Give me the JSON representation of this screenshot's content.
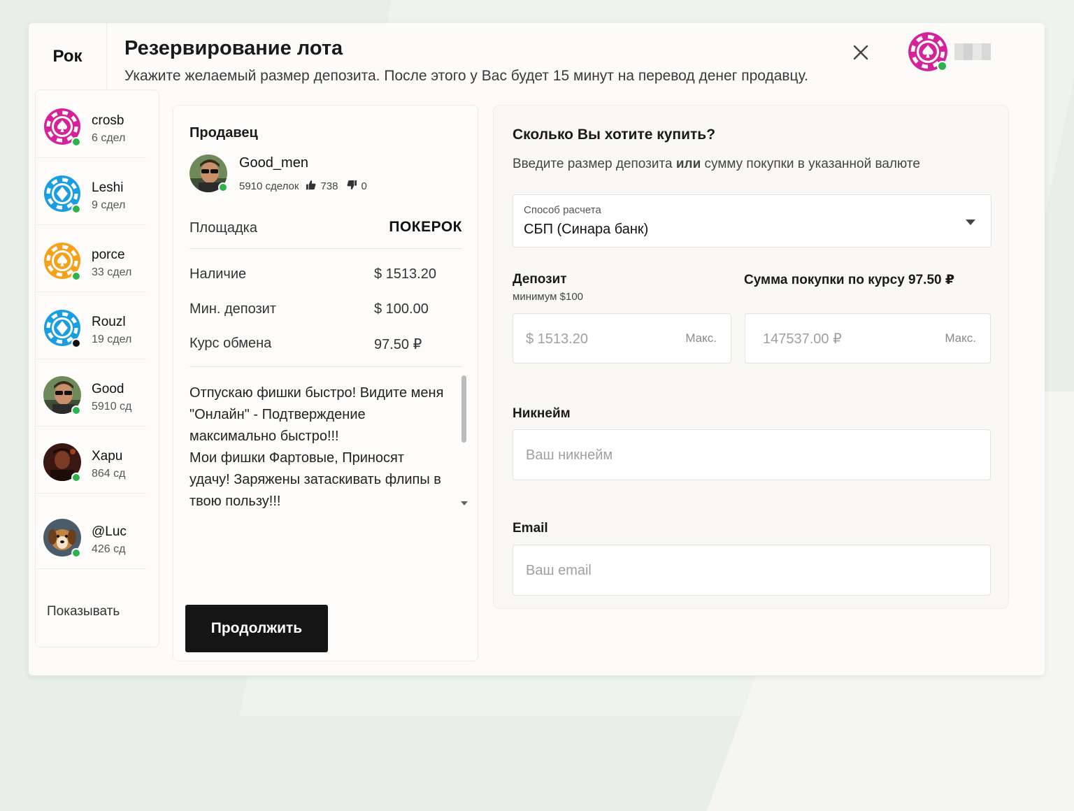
{
  "header": {
    "brand": "Рок",
    "title": "Резервирование лота",
    "subtitle": "Укажите желаемый размер депозита. После этого у Вас будет 15 минут на перевод денег продавцу."
  },
  "sidebar": {
    "items": [
      {
        "name": "crosb",
        "count": "6 сдел"
      },
      {
        "name": "Leshi",
        "count": "9 сдел"
      },
      {
        "name": "porce",
        "count": "33 сдел"
      },
      {
        "name": "Rouzl",
        "count": "19 сдел"
      },
      {
        "name": "Good",
        "count": "5910 сд"
      },
      {
        "name": "Xapu",
        "count": "864 сд"
      },
      {
        "name": "@Luc",
        "count": "426 сд"
      }
    ],
    "more_label": "Показывать"
  },
  "seller": {
    "heading": "Продавец",
    "name": "Good_men",
    "deals": "5910 сделок",
    "likes": "738",
    "dislikes": "0",
    "platform_label": "Площадка",
    "platform_value": "ПОКЕРОК",
    "available_label": "Наличие",
    "available_value": "$ 1513.20",
    "min_deposit_label": "Мин. депозит",
    "min_deposit_value": "$ 100.00",
    "rate_label": "Курс обмена",
    "rate_value": "97.50 ₽",
    "description_1": "Отпускаю фишки быстро! Видите меня \"Онлайн\" - Подтверждение максимально быстро!!!",
    "description_2": "Мои фишки Фартовые, Приносят удачу! Заряжены затаскивать флипы в твою пользу!!!",
    "continue_label": "Продолжить"
  },
  "form": {
    "heading": "Сколько Вы хотите купить?",
    "hint_before": "Введите размер депозита ",
    "hint_bold": "или",
    "hint_after": " сумму покупки в указанной валюте",
    "payment_label": "Способ расчета",
    "payment_value": "СБП (Синара банк)",
    "deposit_label": "Депозит",
    "deposit_sub": "минимум $100",
    "deposit_placeholder": "$ 1513.20",
    "purchase_label": "Сумма покупки по курсу 97.50 ₽",
    "purchase_placeholder": "147537.00 ₽",
    "max_label": "Макс.",
    "nickname_label": "Никнейм",
    "nickname_placeholder": "Ваш никнейм",
    "email_label": "Email",
    "email_placeholder": "Ваш email"
  },
  "colors": {
    "chip_magenta": "#d4239a",
    "chip_blue": "#1a9ee0",
    "chip_orange": "#f5a11a",
    "online": "#2bb34a",
    "button": "#151515"
  }
}
